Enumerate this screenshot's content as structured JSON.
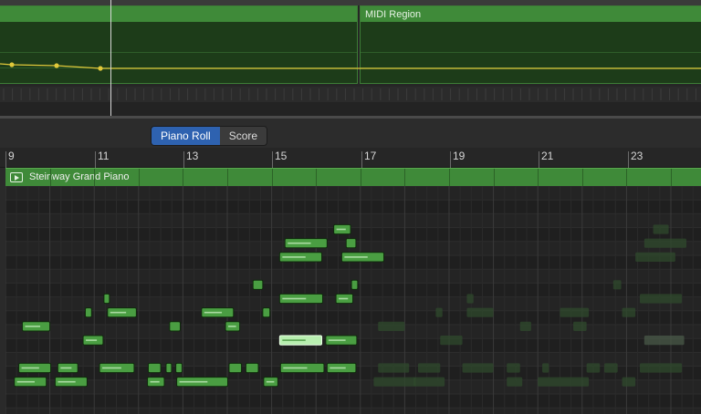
{
  "tracks": {
    "region_name": "MIDI Region"
  },
  "editor": {
    "tabs": [
      {
        "label": "Piano Roll",
        "active": true
      },
      {
        "label": "Score",
        "active": false
      }
    ],
    "ruler": {
      "bars": [
        9,
        11,
        13,
        15,
        17,
        19,
        21,
        23
      ]
    },
    "region_label": "Steinway Grand Piano"
  },
  "colors": {
    "region_green": "#3f8a39",
    "note_fill": "#4a9e42",
    "note_selected": "#b8efb0",
    "tab_active": "#2e62b0",
    "automation_line": "#e0c83a"
  },
  "notes": [
    {
      "bar": 16.4,
      "len": 0.38,
      "row": 2
    },
    {
      "bar": 15.3,
      "len": 0.95,
      "row": 3
    },
    {
      "bar": 16.68,
      "len": 0.22,
      "row": 3
    },
    {
      "bar": 15.18,
      "len": 0.95,
      "row": 4
    },
    {
      "bar": 16.58,
      "len": 0.95,
      "row": 4
    },
    {
      "bar": 14.58,
      "len": 0.22,
      "row": 6
    },
    {
      "bar": 16.8,
      "len": 0.14,
      "row": 6
    },
    {
      "bar": 11.22,
      "len": 0.12,
      "row": 7
    },
    {
      "bar": 15.18,
      "len": 0.97,
      "row": 7
    },
    {
      "bar": 16.45,
      "len": 0.38,
      "row": 7
    },
    {
      "bar": 10.8,
      "len": 0.14,
      "row": 8
    },
    {
      "bar": 11.3,
      "len": 0.65,
      "row": 8
    },
    {
      "bar": 13.42,
      "len": 0.72,
      "row": 8
    },
    {
      "bar": 14.8,
      "len": 0.16,
      "row": 8
    },
    {
      "bar": 9.38,
      "len": 0.62,
      "row": 9
    },
    {
      "bar": 12.7,
      "len": 0.24,
      "row": 9
    },
    {
      "bar": 13.96,
      "len": 0.32,
      "row": 9
    },
    {
      "bar": 10.75,
      "len": 0.45,
      "row": 10
    },
    {
      "bar": 15.18,
      "len": 0.95,
      "row": 10,
      "selected": true
    },
    {
      "bar": 16.22,
      "len": 0.7,
      "row": 10
    },
    {
      "bar": 9.3,
      "len": 0.72,
      "row": 12
    },
    {
      "bar": 10.18,
      "len": 0.45,
      "row": 12
    },
    {
      "bar": 11.12,
      "len": 0.78,
      "row": 12
    },
    {
      "bar": 12.22,
      "len": 0.28,
      "row": 12
    },
    {
      "bar": 12.62,
      "len": 0.12,
      "row": 12
    },
    {
      "bar": 12.84,
      "len": 0.14,
      "row": 12
    },
    {
      "bar": 14.04,
      "len": 0.28,
      "row": 12
    },
    {
      "bar": 14.42,
      "len": 0.28,
      "row": 12
    },
    {
      "bar": 15.2,
      "len": 0.98,
      "row": 12
    },
    {
      "bar": 16.25,
      "len": 0.65,
      "row": 12
    },
    {
      "bar": 9.2,
      "len": 0.72,
      "row": 13
    },
    {
      "bar": 10.12,
      "len": 0.72,
      "row": 13
    },
    {
      "bar": 12.2,
      "len": 0.38,
      "row": 13
    },
    {
      "bar": 12.86,
      "len": 1.15,
      "row": 13
    },
    {
      "bar": 14.82,
      "len": 0.32,
      "row": 13
    }
  ],
  "ghost_notes": [
    {
      "bar": 23.6,
      "len": 0.35,
      "row": 2
    },
    {
      "bar": 23.4,
      "len": 0.95,
      "row": 3
    },
    {
      "bar": 23.2,
      "len": 0.9,
      "row": 4
    },
    {
      "bar": 22.7,
      "len": 0.18,
      "row": 6
    },
    {
      "bar": 19.4,
      "len": 0.15,
      "row": 7
    },
    {
      "bar": 23.3,
      "len": 0.95,
      "row": 7
    },
    {
      "bar": 18.7,
      "len": 0.15,
      "row": 8
    },
    {
      "bar": 19.4,
      "len": 0.6,
      "row": 8
    },
    {
      "bar": 21.5,
      "len": 0.65,
      "row": 8
    },
    {
      "bar": 22.9,
      "len": 0.3,
      "row": 8
    },
    {
      "bar": 17.4,
      "len": 0.6,
      "row": 9
    },
    {
      "bar": 20.6,
      "len": 0.25,
      "row": 9
    },
    {
      "bar": 21.8,
      "len": 0.3,
      "row": 9
    },
    {
      "bar": 18.8,
      "len": 0.5,
      "row": 10
    },
    {
      "bar": 23.4,
      "len": 0.9,
      "row": 10,
      "selected": true
    },
    {
      "bar": 17.4,
      "len": 0.7,
      "row": 12
    },
    {
      "bar": 18.3,
      "len": 0.5,
      "row": 12
    },
    {
      "bar": 19.3,
      "len": 0.7,
      "row": 12
    },
    {
      "bar": 20.3,
      "len": 0.3,
      "row": 12
    },
    {
      "bar": 21.1,
      "len": 0.15,
      "row": 12
    },
    {
      "bar": 22.1,
      "len": 0.3,
      "row": 12
    },
    {
      "bar": 22.5,
      "len": 0.3,
      "row": 12
    },
    {
      "bar": 23.3,
      "len": 0.95,
      "row": 12
    },
    {
      "bar": 17.3,
      "len": 0.95,
      "row": 13
    },
    {
      "bar": 18.2,
      "len": 0.7,
      "row": 13
    },
    {
      "bar": 20.3,
      "len": 0.35,
      "row": 13
    },
    {
      "bar": 21.0,
      "len": 1.15,
      "row": 13
    },
    {
      "bar": 22.9,
      "len": 0.3,
      "row": 13
    }
  ]
}
